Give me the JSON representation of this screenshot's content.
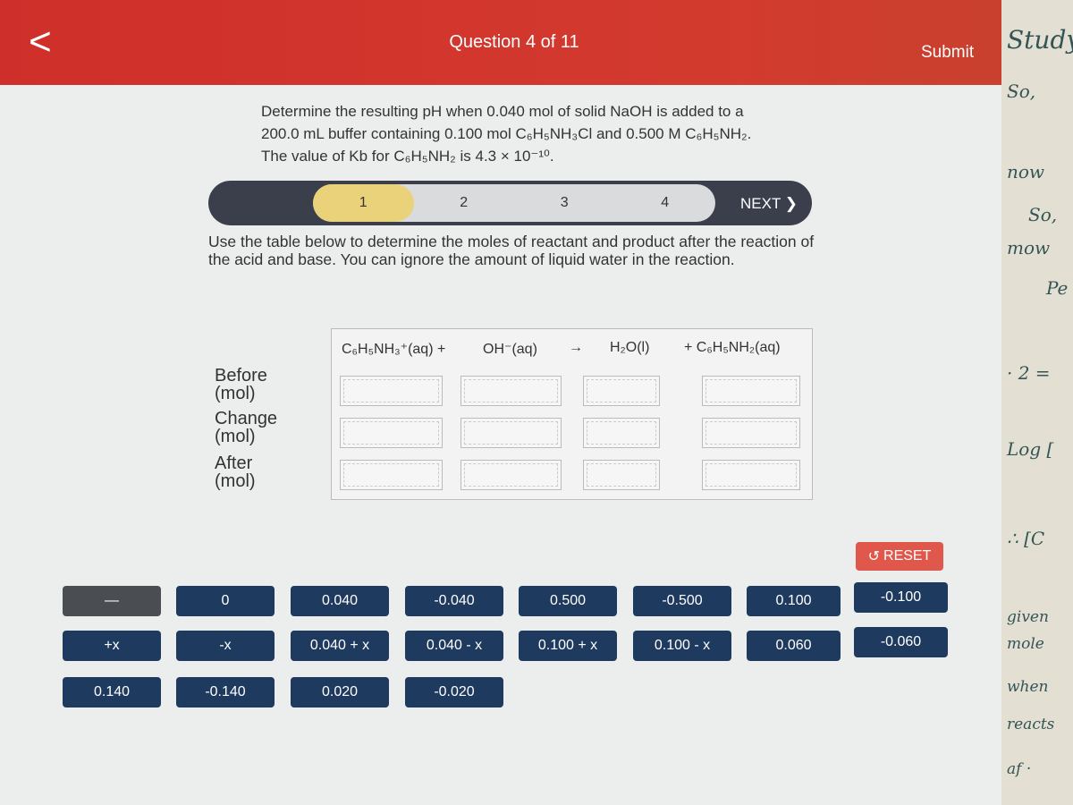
{
  "header": {
    "back_icon": "chevron-left-icon",
    "title": "Question 4 of 11",
    "submit_label": "Submit"
  },
  "question": {
    "text": "Determine the resulting pH when 0.040 mol of solid NaOH is added to a 200.0 mL buffer containing 0.100 mol C₆H₅NH₃Cl and 0.500 M C₆H₅NH₂. The value of Kb for C₆H₅NH₂ is 4.3 × 10⁻¹⁰."
  },
  "steps": {
    "items": [
      "1",
      "2",
      "3",
      "4"
    ],
    "active": "1",
    "next_label": "NEXT ❯"
  },
  "instruction": "Use the table below to determine the moles of reactant and product after the reaction of the acid and base. You can ignore the amount of liquid water in the reaction.",
  "table": {
    "equation": [
      "C₆H₅NH₃⁺(aq) +",
      "OH⁻(aq)",
      "→",
      "H₂O(l)",
      "+ C₆H₅NH₂(aq)"
    ],
    "rows": [
      "Before (mol)",
      "Change (mol)",
      "After (mol)"
    ]
  },
  "reset_label": "RESET",
  "answer_tiles": [
    [
      "—",
      "0",
      "0.040",
      "-0.040",
      "0.500",
      "-0.500",
      "0.100",
      "-0.100"
    ],
    [
      "+x",
      "-x",
      "0.040 + x",
      "0.040 - x",
      "0.100 + x",
      "0.100 - x",
      "0.060",
      "-0.060"
    ],
    [
      "0.140",
      "-0.140",
      "0.020",
      "-0.020"
    ]
  ],
  "notes": [
    "Study",
    "So,",
    "now",
    "So,",
    "mow",
    "Pe",
    "· 2 =",
    "Log [",
    "∴ [C",
    "given",
    "mole",
    "when",
    "reacts",
    "af ·"
  ],
  "colors": {
    "header": "#cf2f2a",
    "tile": "#1f3a5f",
    "reset": "#e0574b",
    "active_step": "#ead27a"
  }
}
